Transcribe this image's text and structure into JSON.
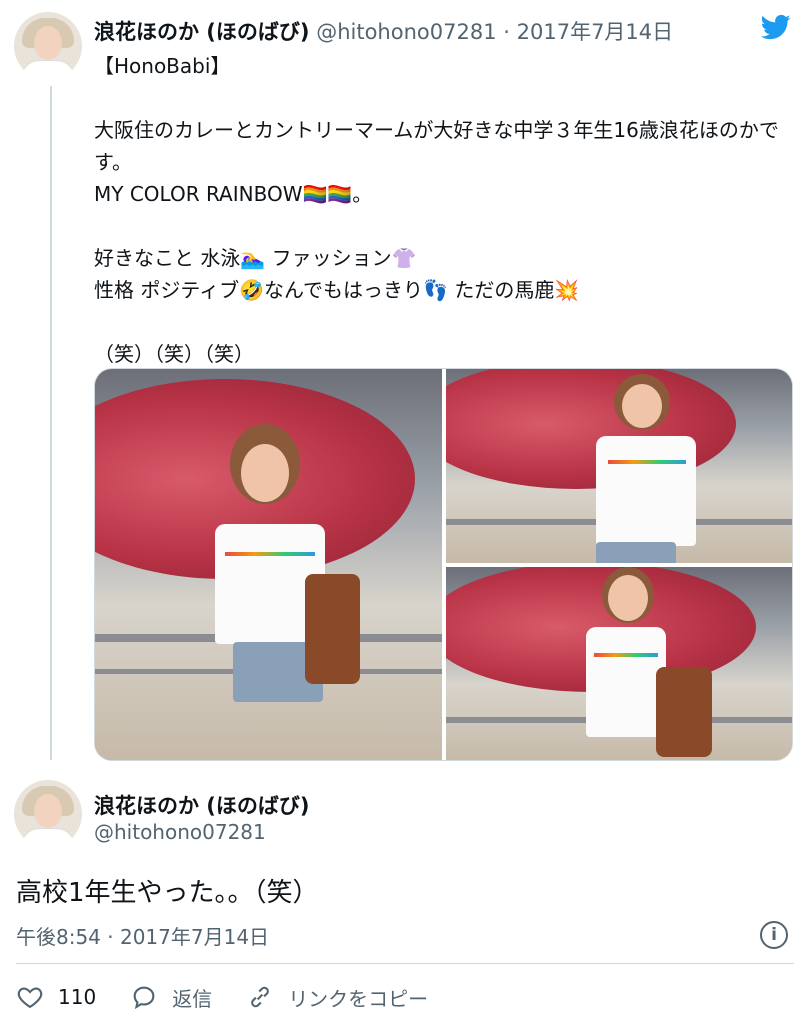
{
  "tweet1": {
    "display_name": "浪花ほのか (ほのばび)",
    "handle": "@hitohono07281",
    "separator": "·",
    "date": "2017年7月14日",
    "text": "【HonoBabi】\n\n大阪住のカレーとカントリーマームが大好きな中学３年生16歳浪花ほのかです。\nMY COLOR  RAINBOW🏳️‍🌈🏳️‍🌈。\n\n好きなこと 水泳🏊‍♀️  ファッション👚\n性格   ポジティブ🤣なんでもはっきり👣 ただの馬鹿💥\n\n（笑）（笑）（笑）"
  },
  "tweet2": {
    "display_name": "浪花ほのか (ほのばび)",
    "handle": "@hitohono07281",
    "text": "高校1年生やった。。（笑）",
    "timestamp": "午後8:54 · 2017年7月14日"
  },
  "actions": {
    "like_count": "110",
    "reply_label": "返信",
    "copy_link_label": "リンクをコピー"
  },
  "icons": {
    "info": "i"
  },
  "colors": {
    "twitter_blue": "#1d9bf0",
    "muted": "#536471"
  }
}
